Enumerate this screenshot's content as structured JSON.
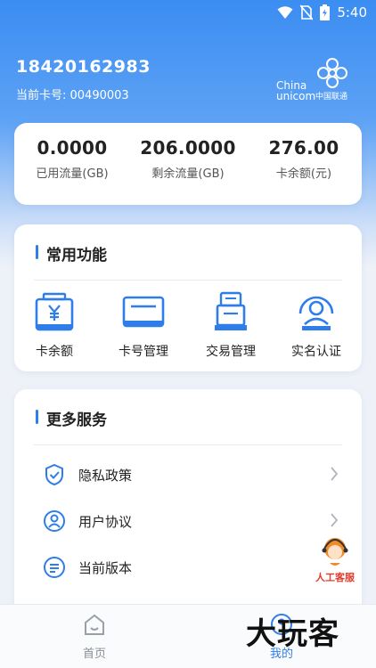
{
  "status_bar": {
    "time": "5:40"
  },
  "account": {
    "phone": "18420162983",
    "card_number": "当前卡号: 00490003"
  },
  "logo": {
    "line1": "China",
    "line2": "unicom",
    "cn": "中国联通"
  },
  "stats": [
    {
      "value": "0.0000",
      "label": "已用流量(GB)"
    },
    {
      "value": "206.0000",
      "label": "剩余流量(GB)"
    },
    {
      "value": "276.00",
      "label": "卡余额(元)"
    }
  ],
  "common_functions": {
    "title": "常用功能",
    "items": [
      {
        "label": "卡余额",
        "icon": "wallet-yuan-icon"
      },
      {
        "label": "卡号管理",
        "icon": "card-icon"
      },
      {
        "label": "交易管理",
        "icon": "printer-icon"
      },
      {
        "label": "实名认证",
        "icon": "user-verify-icon"
      }
    ]
  },
  "more_services": {
    "title": "更多服务",
    "items": [
      {
        "label": "隐私政策",
        "icon": "shield-check-icon"
      },
      {
        "label": "用户协议",
        "icon": "user-circle-icon"
      },
      {
        "label": "当前版本",
        "icon": "list-circle-icon"
      }
    ]
  },
  "customer_service": {
    "label": "人工客服"
  },
  "bottom_nav": {
    "home": "首页",
    "mine": "我的"
  },
  "watermark": "大玩客",
  "colors": {
    "accent": "#2f7de8",
    "service_red": "#e23b2c"
  }
}
